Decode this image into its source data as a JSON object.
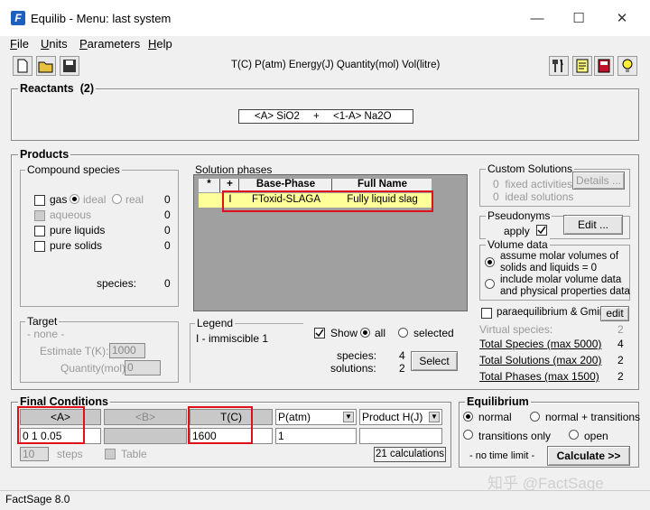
{
  "window": {
    "title": "Equilib - Menu: last system",
    "icon_letter": "F"
  },
  "menu": [
    {
      "label": "File",
      "key": "F",
      "rest": "ile"
    },
    {
      "label": "Units",
      "key": "U",
      "rest": "nits"
    },
    {
      "label": "Parameters",
      "key": "P",
      "rest": "arameters"
    },
    {
      "label": "Help",
      "key": "H",
      "rest": "elp"
    }
  ],
  "toolbar": {
    "units": "T(C)  P(atm)  Energy(J)  Quantity(mol)  Vol(litre)"
  },
  "reactants": {
    "title": "Reactants",
    "count": "(2)",
    "formula_a": "<A> SiO2",
    "plus": "+",
    "formula_b": "<1-A> Na2O"
  },
  "products": {
    "title": "Products",
    "compound": {
      "title": "Compound species",
      "gas_label": "gas",
      "ideal_label": "ideal",
      "real_label": "real",
      "gas_count": "0",
      "aqueous_label": "aqueous",
      "aqueous_count": "0",
      "liquids_label": "pure liquids",
      "liquids_count": "0",
      "solids_label": "pure solids",
      "solids_count": "0",
      "species_label": "species:",
      "species_count": "0"
    },
    "solution": {
      "title": "Solution phases",
      "headers": [
        "*",
        "+",
        "Base-Phase",
        "Full Name"
      ],
      "row": {
        "star": "",
        "plus": "I",
        "base": "FToxid-SLAGA",
        "full": "Fully liquid slag"
      }
    },
    "target": {
      "title": "Target",
      "none": "- none -",
      "estimate_label": "Estimate T(K):",
      "estimate_value": "1000",
      "quantity_label": "Quantity(mol):",
      "quantity_value": "0"
    },
    "legend": {
      "title": "Legend",
      "text": "I - immiscible  1"
    },
    "show": {
      "label": "Show",
      "all": "all",
      "selected": "selected"
    },
    "counts": {
      "species_label": "species:",
      "species_value": "4",
      "solutions_label": "solutions:",
      "solutions_value": "2",
      "select_label": "Select"
    },
    "custom": {
      "title": "Custom Solutions",
      "fixed_count": "0",
      "fixed_label": "fixed activities",
      "ideal_count": "0",
      "ideal_label": "ideal solutions",
      "details_label": "Details ..."
    },
    "pseudonyms": {
      "title": "Pseudonyms",
      "apply_label": "apply",
      "edit_label": "Edit ..."
    },
    "volume": {
      "title": "Volume data",
      "opt1_line1": "assume molar volumes of",
      "opt1_line2": "solids and liquids = 0",
      "opt2_line1": "include molar volume data",
      "opt2_line2": "and physical properties data"
    },
    "para": {
      "label": "paraequilibrium & Gmin",
      "edit_label": "edit"
    },
    "totals": {
      "virtual_label": "Virtual species:",
      "virtual_value": "2",
      "species_label": "Total Species (max 5000)",
      "species_value": "4",
      "solutions_label": "Total Solutions (max 200)",
      "solutions_value": "2",
      "phases_label": "Total Phases (max 1500)",
      "phases_value": "2"
    }
  },
  "final": {
    "title": "Final Conditions",
    "headers": {
      "a": "<A>",
      "b": "<B>",
      "t": "T(C)",
      "p": "P(atm)",
      "h": "Product H(J)"
    },
    "values": {
      "a": "0 1 0.05",
      "b": "",
      "t": "1600",
      "p": "1",
      "h": ""
    },
    "steps_value": "10",
    "steps_label": "steps",
    "table_label": "Table",
    "calc_count": "21 calculations"
  },
  "equilibrium": {
    "title": "Equilibrium",
    "normal": "normal",
    "normal_trans": "normal + transitions",
    "trans_only": "transitions only",
    "open": "open",
    "time_limit": "- no time limit -",
    "calculate": "Calculate >>"
  },
  "status": {
    "text": "FactSage 8.0"
  },
  "watermark": "知乎 @FactSage"
}
